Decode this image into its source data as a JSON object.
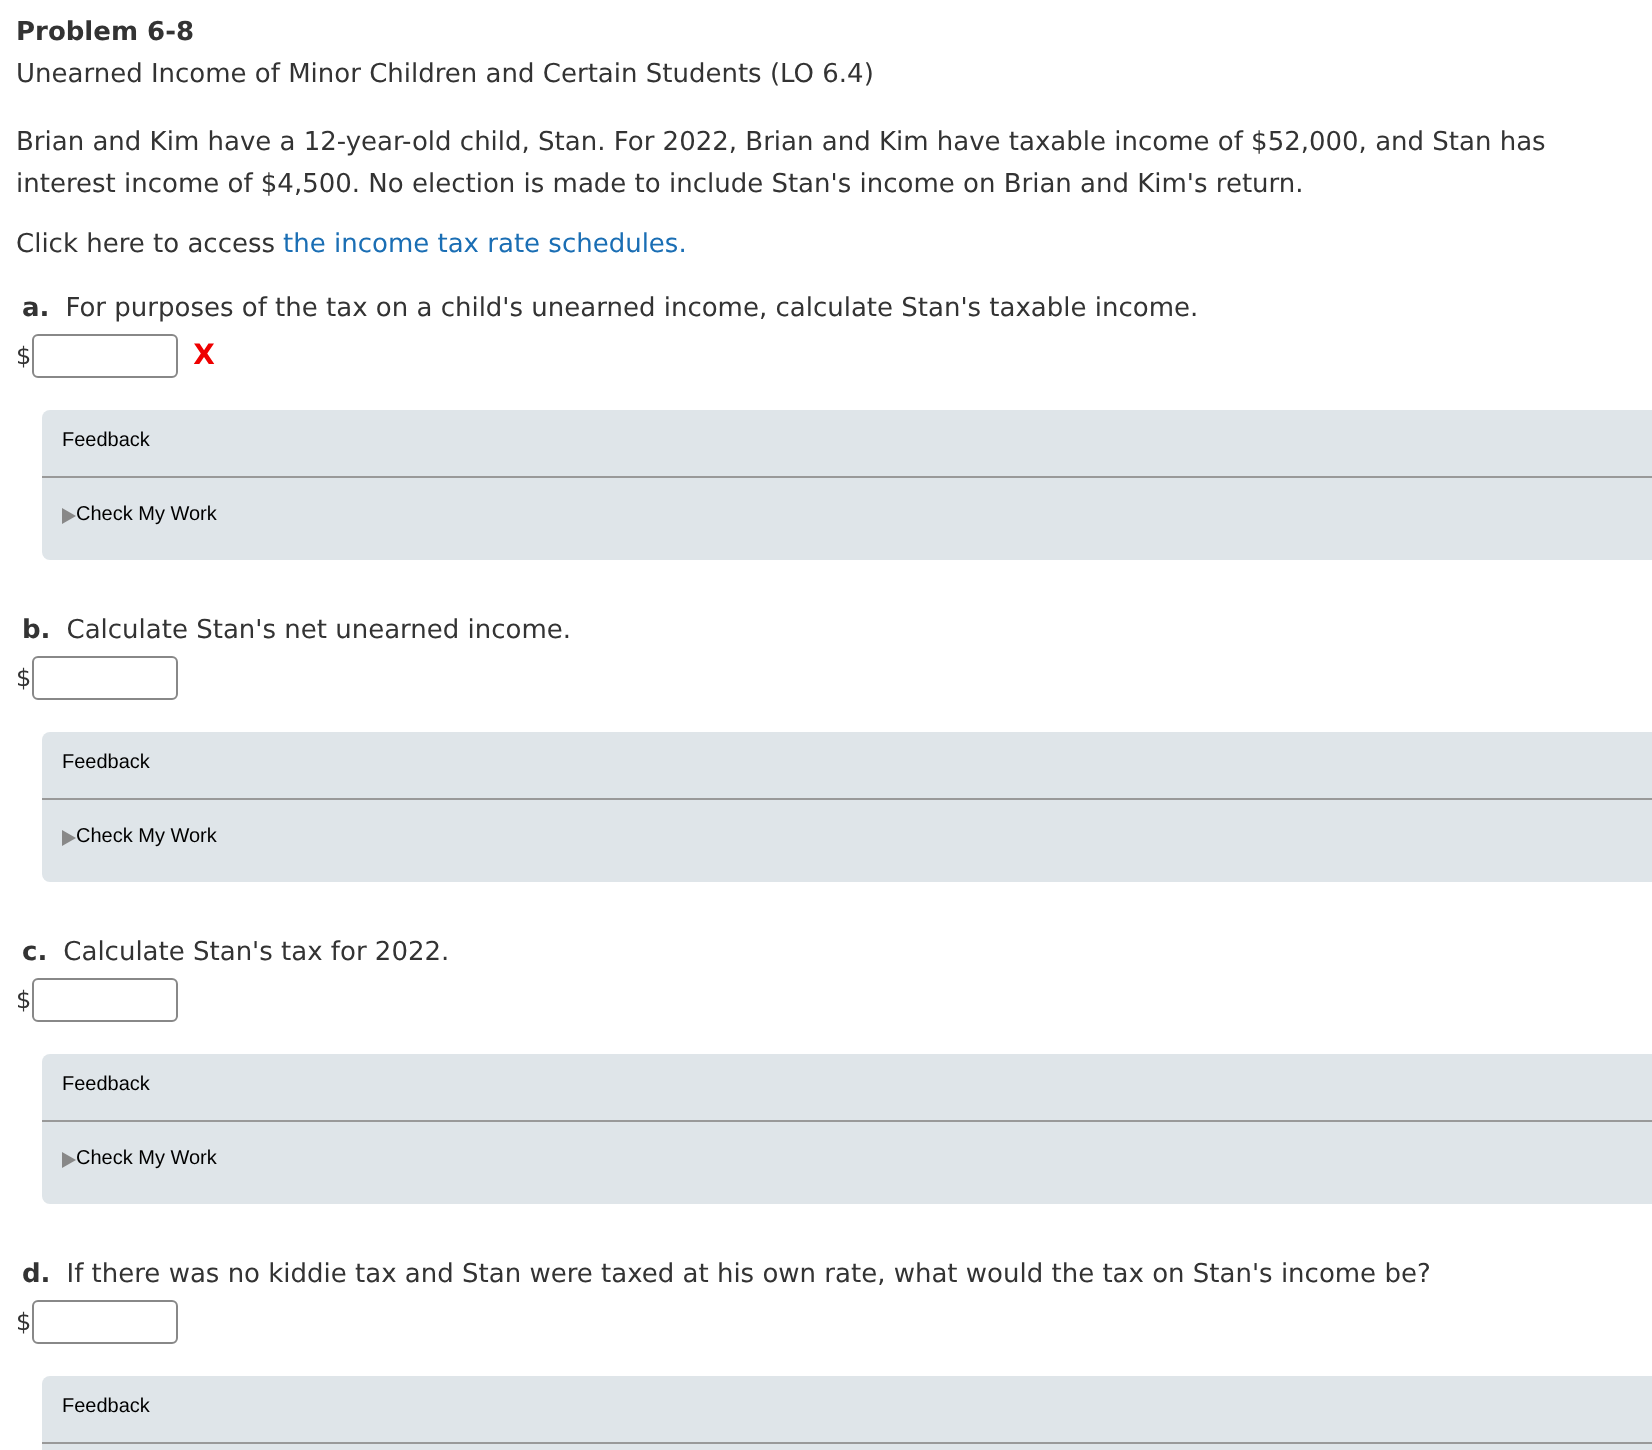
{
  "title": "Problem 6-8",
  "subtitle": "Unearned Income of Minor Children and Certain Students (LO 6.4)",
  "intro": "Brian and Kim have a 12-year-old child, Stan. For 2022, Brian and Kim have taxable income of $52,000, and Stan has interest income of $4,500. No election is made to include Stan's income on Brian and Kim's return.",
  "access": {
    "text": "Click here to access",
    "link": "the income tax rate schedules."
  },
  "questions": [
    {
      "letter": "a.",
      "text": "For purposes of the tax on a child's unearned income, calculate Stan's taxable income.",
      "currency": "$",
      "mark": "X",
      "feedback": {
        "label": "Feedback",
        "check": "Check My Work"
      }
    },
    {
      "letter": "b.",
      "text": "Calculate Stan's net unearned income.",
      "currency": "$",
      "feedback": {
        "label": "Feedback",
        "check": "Check My Work"
      }
    },
    {
      "letter": "c.",
      "text": "Calculate Stan's tax for 2022.",
      "currency": "$",
      "feedback": {
        "label": "Feedback",
        "check": "Check My Work"
      }
    },
    {
      "letter": "d.",
      "text": "If there was no kiddie tax and Stan were taxed at his own rate, what would the tax on Stan's income be?",
      "currency": "$",
      "feedback": {
        "label": "Feedback"
      }
    }
  ]
}
